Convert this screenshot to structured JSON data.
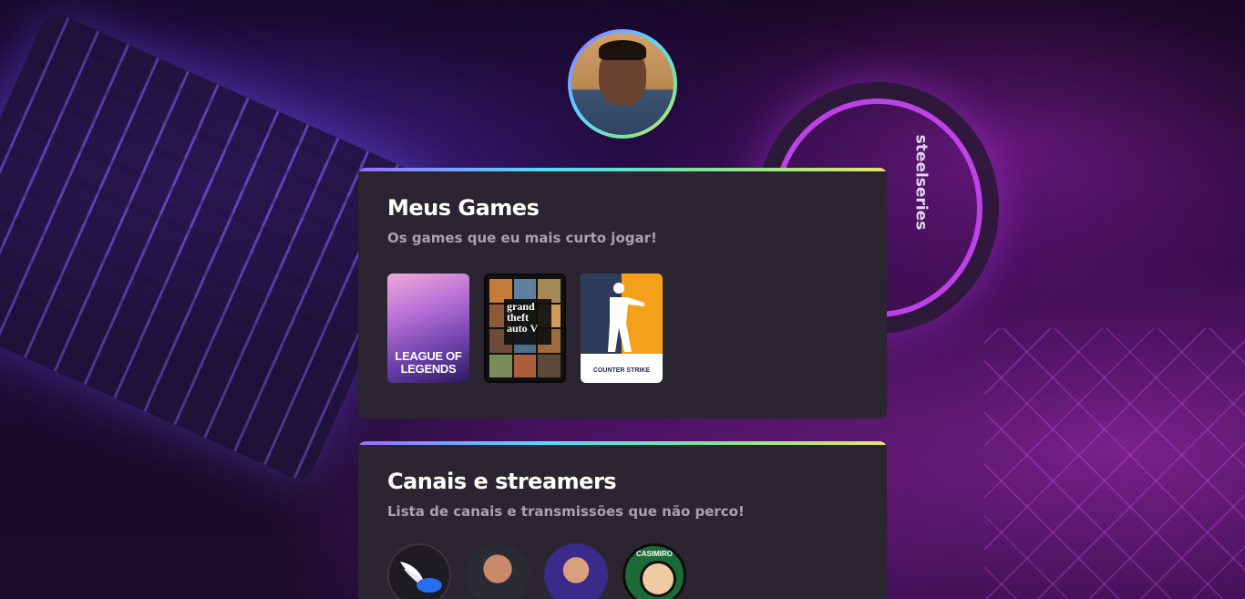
{
  "background": {
    "headset_brand": "steelseries"
  },
  "profile": {
    "avatar_alt": "Foto de perfil"
  },
  "games_section": {
    "title": "Meus Games",
    "subtitle": "Os games que eu mais curto jogar!",
    "games": [
      {
        "name": "League of Legends",
        "cover_text_line1": "LEAGUE OF",
        "cover_text_line2": "LEGENDS"
      },
      {
        "name": "Grand Theft Auto V",
        "cover_text": "grand theft auto V"
      },
      {
        "name": "Counter-Strike",
        "cover_text": "COUNTER STRIKE"
      }
    ]
  },
  "channels_section": {
    "title": "Canais e streamers",
    "subtitle": "Lista de canais e transmissões que não perco!",
    "channels": [
      {
        "name": "wings-channel"
      },
      {
        "name": "streamer-1"
      },
      {
        "name": "streamer-2"
      },
      {
        "name": "casimiro",
        "badge_text": "CASIMIRO"
      }
    ]
  },
  "colors": {
    "card_bg": "#2a2530",
    "gradient": [
      "#9a6bff",
      "#56d9ff",
      "#7de39a",
      "#e6e56a"
    ],
    "title": "#ffffff",
    "subtitle": "#a8a3b0"
  }
}
